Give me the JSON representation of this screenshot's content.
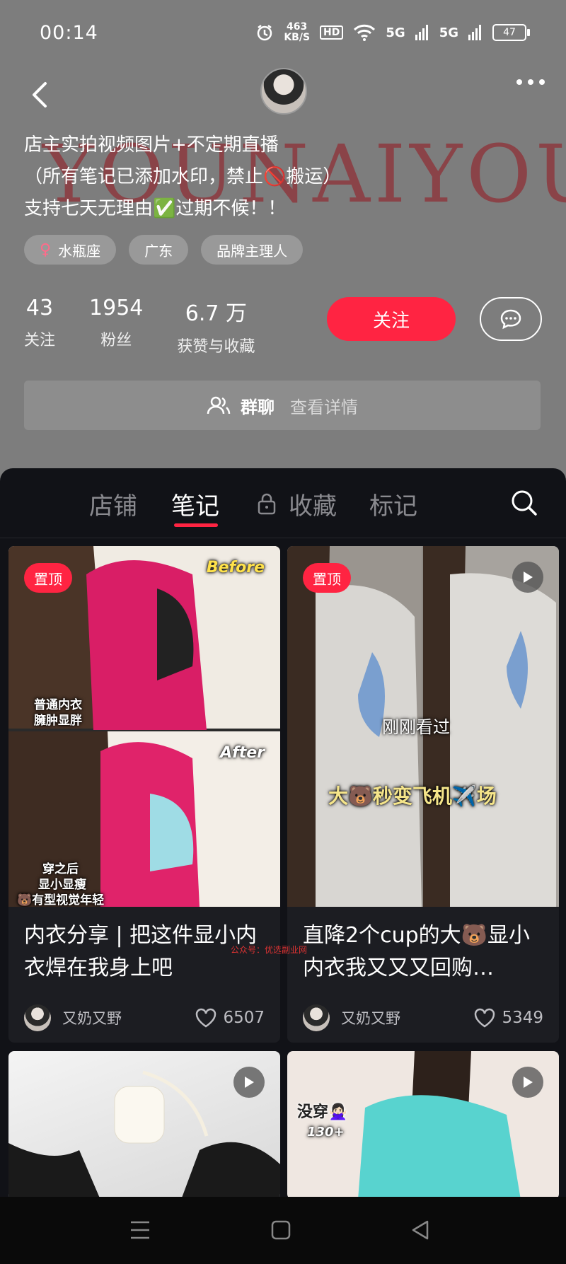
{
  "status_bar": {
    "time": "00:14",
    "net_speed": "463",
    "net_unit": "KB/S",
    "hd": "HD",
    "sig1": "5G",
    "sig2": "5G",
    "battery": "47"
  },
  "watermark": "YOUNAIYOUY",
  "bio": [
    "店主实拍视频图片+不定期直播",
    "（所有笔记已添加水印，禁止🚫搬运）",
    "支持七天无理由✅过期不候！！"
  ],
  "tags": [
    {
      "label": "水瓶座",
      "icon": "female-icon"
    },
    {
      "label": "广东"
    },
    {
      "label": "品牌主理人"
    }
  ],
  "stats": [
    {
      "num": "43",
      "label": "关注"
    },
    {
      "num": "1954",
      "label": "粉丝"
    },
    {
      "num": "6.7 万",
      "label": "获赞与收藏"
    }
  ],
  "follow_label": "关注",
  "group_chat": {
    "title": "群聊",
    "link": "查看详情"
  },
  "tabs": [
    "店铺",
    "笔记",
    "收藏",
    "标记"
  ],
  "notes": [
    {
      "pin": "置顶",
      "title": "内衣分享 | 把这件显小内衣焊在我身上吧",
      "author": "又奶又野",
      "likes": "6507",
      "overlays": {
        "before": "Before",
        "after": "After",
        "caption_top_1": "普通内衣",
        "caption_top_2": "臃肿显胖",
        "caption_bottom_1": "穿之后",
        "caption_bottom_2": "显小显瘦",
        "caption_bottom_3": "🐻有型视觉年轻"
      }
    },
    {
      "pin": "置顶",
      "title": "直降2个cup的大🐻显小内衣我又又又回购…",
      "author": "又奶又野",
      "likes": "5349",
      "overlays": {
        "recent": "刚刚看过",
        "headline": "大🐻秒变飞机✈️场"
      }
    },
    {
      "title": "",
      "author": ""
    },
    {
      "overlays": {
        "top": "没穿🙅🏻‍♀️",
        "size": "130+"
      }
    }
  ],
  "watermark_small": "公众号：优选副业网",
  "colors": {
    "accent": "#ff2442",
    "panel": "#111217",
    "card": "#1c1d22"
  }
}
